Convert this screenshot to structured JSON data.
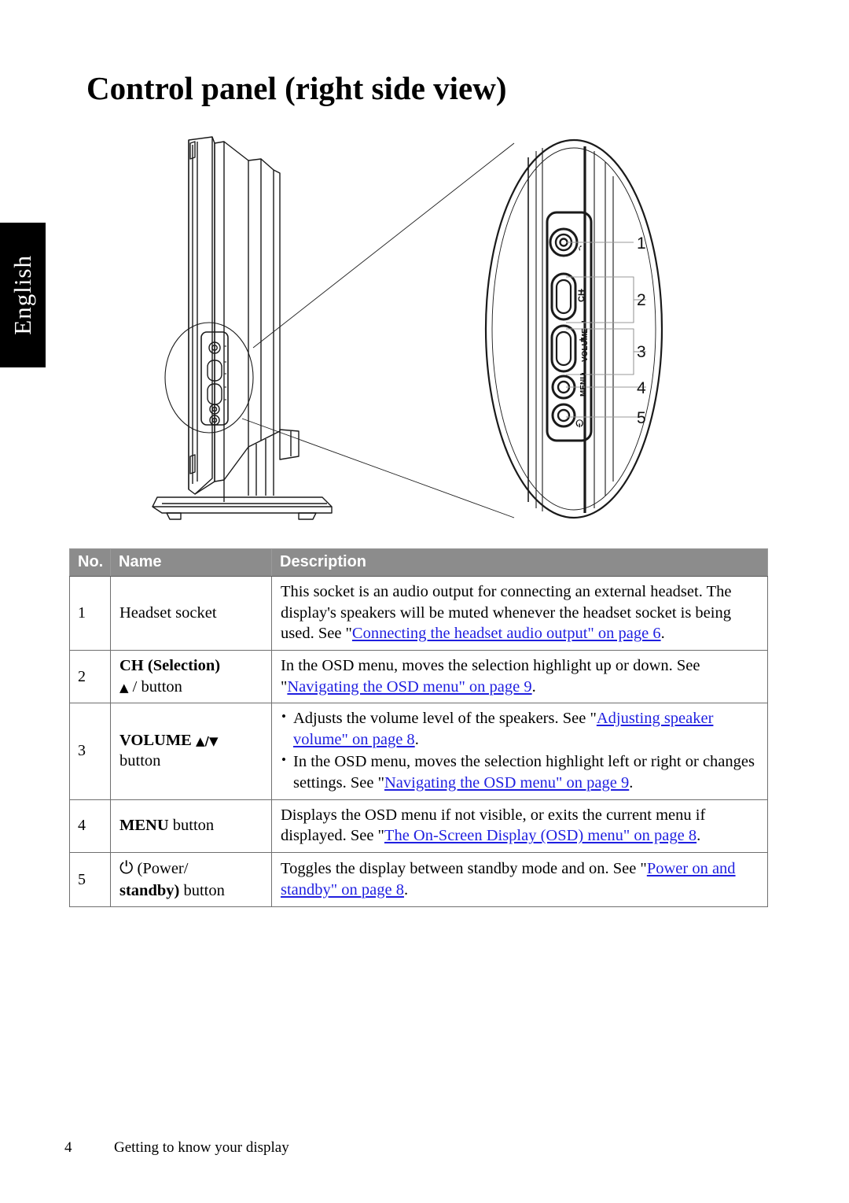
{
  "language_tab": {
    "label": "English"
  },
  "page_title": "Control panel (right side view)",
  "figure": {
    "caption_numbers": [
      "1",
      "2",
      "3",
      "4",
      "5"
    ],
    "panel_labels": {
      "headset": "headphone-socket",
      "channel": "CH",
      "channel_plus": "+",
      "channel_minus": "-",
      "volume": "VOLUME",
      "volume_plus": "+",
      "volume_minus": "-",
      "menu": "MENU",
      "power": "power-symbol"
    }
  },
  "table": {
    "headers": {
      "no": "No.",
      "name": "Name",
      "description": "Description"
    },
    "rows": [
      {
        "no": "1",
        "name_line1": "Headset socket",
        "name_line2": "",
        "desc_pre": "This socket is an audio output for connecting an external headset. The display's speakers will be muted whenever the headset socket is being used. See \"",
        "desc_link": "Connecting the headset audio output\" on page 6",
        "desc_post": "."
      },
      {
        "no": "2",
        "name_line1": "CH (Selection)",
        "name_line2": "/ button",
        "desc_pre": "In the OSD menu, moves the selection highlight up or down. See \"",
        "desc_link": "Navigating the OSD menu\" on page 9",
        "desc_post": "."
      },
      {
        "no": "3",
        "name_line1": "VOLUME",
        "name_line2": "button",
        "bullet1_pre": "Adjusts the volume level of the speakers. See \"",
        "bullet1_link": "Adjusting speaker volume\" on page 8",
        "bullet1_post": ".",
        "bullet2_pre": "In the OSD menu, moves the selection highlight left or right or changes settings. See \"",
        "bullet2_link": "Navigating the OSD menu\" on page 9",
        "bullet2_post": "."
      },
      {
        "no": "4",
        "name_bold": "MENU",
        "name_rest": " button",
        "desc_pre": "Displays the OSD menu if not visible, or exits the current menu if displayed. See \"",
        "desc_link": "The On-Screen Display (OSD) menu\" on page 8",
        "desc_post": "."
      },
      {
        "no": "5",
        "name_line1": "(Power/",
        "name_line2_bold": "standby)",
        "name_line2_rest": " button",
        "desc_pre": "Toggles the display between standby mode and on. See \"",
        "desc_link": "Power on and standby\" on page 8",
        "desc_post": "."
      }
    ]
  },
  "footer": {
    "page_number": "4",
    "section": "Getting to know your display"
  },
  "colors": {
    "header_gray": "#8c8c8c",
    "link_blue": "#1f1fe0",
    "tab_black": "#000000"
  }
}
